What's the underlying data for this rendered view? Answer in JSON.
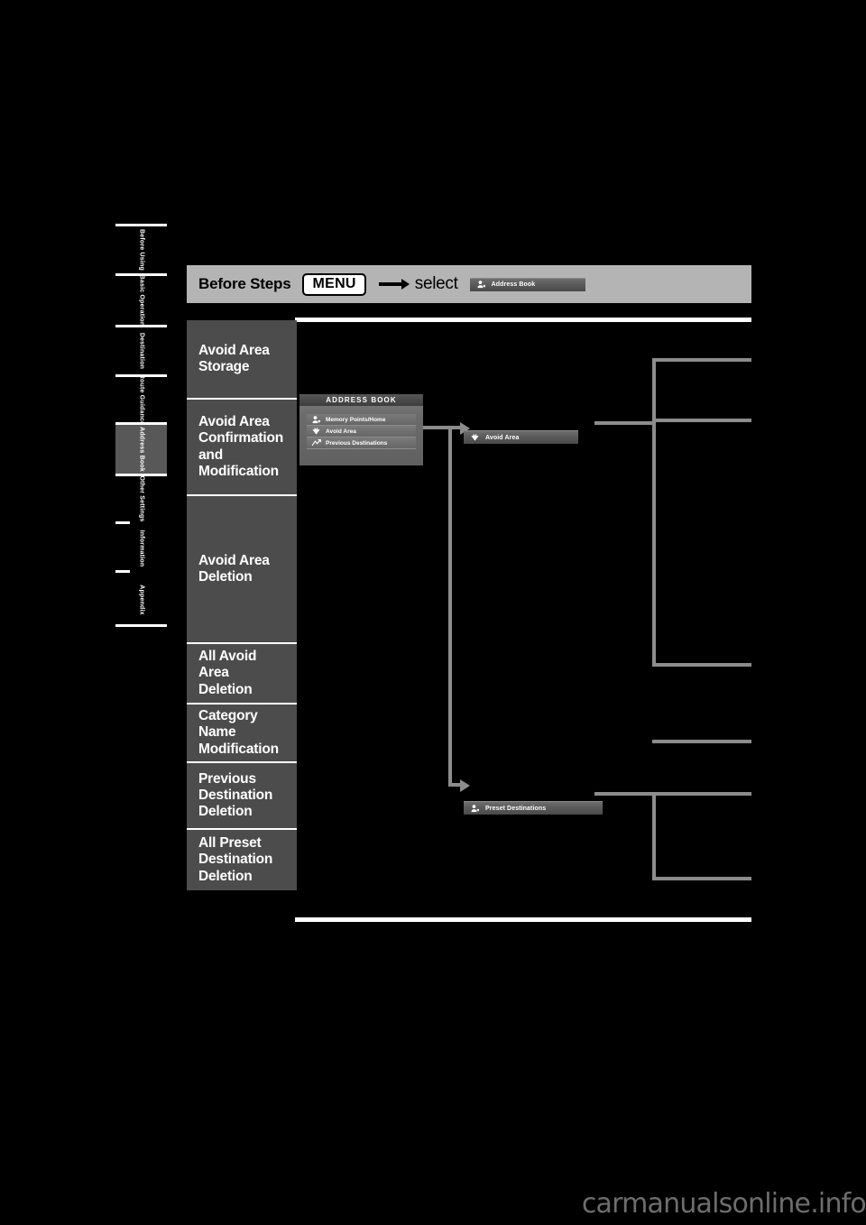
{
  "page": {
    "background": "#000000",
    "watermark": "carmanualsonline.info"
  },
  "side_tabs": [
    {
      "label": "Before Using",
      "active": false
    },
    {
      "label": "Basic Operation",
      "active": false
    },
    {
      "label": "Destination",
      "active": false
    },
    {
      "label": "Route Guidance",
      "active": false
    },
    {
      "label": "Address Book",
      "active": true
    },
    {
      "label": "Other Settings",
      "active": false
    },
    {
      "label": "Information",
      "active": false
    },
    {
      "label": "Appendix",
      "active": false
    }
  ],
  "before_steps": {
    "title": "Before Steps",
    "key": "MENU",
    "arrow_icon": "right-arrow-icon",
    "select_word": "select",
    "target_button": {
      "label": "Address Book",
      "icon": "address-book-icon"
    }
  },
  "procedures": [
    {
      "label": "Avoid Area\nStorage"
    },
    {
      "label": "Avoid Area\nConfirmation\nand\nModification"
    },
    {
      "label": "Avoid Area\nDeletion"
    },
    {
      "label": "All Avoid\nArea\nDeletion"
    },
    {
      "label": "Category\nName\nModification"
    },
    {
      "label": "Previous\nDestination\nDeletion"
    },
    {
      "label": "All Preset\nDestination\nDeletion"
    }
  ],
  "address_book_screen": {
    "title": "ADDRESS BOOK",
    "items": [
      {
        "label": "Memory Points/Home",
        "icon": "memory-point-icon"
      },
      {
        "label": "Avoid Area",
        "icon": "avoid-area-icon"
      },
      {
        "label": "Previous Destinations",
        "icon": "previous-destinations-icon"
      }
    ]
  },
  "flow_buttons": [
    {
      "label": "Avoid Area",
      "icon": "avoid-area-icon"
    },
    {
      "label": "Preset Destinations",
      "icon": "preset-destinations-icon"
    }
  ],
  "colors": {
    "panel": "#4c4c4c",
    "header_band": "#b4b4b4",
    "connector": "#8c8c8c",
    "rule": "#ffffff"
  }
}
